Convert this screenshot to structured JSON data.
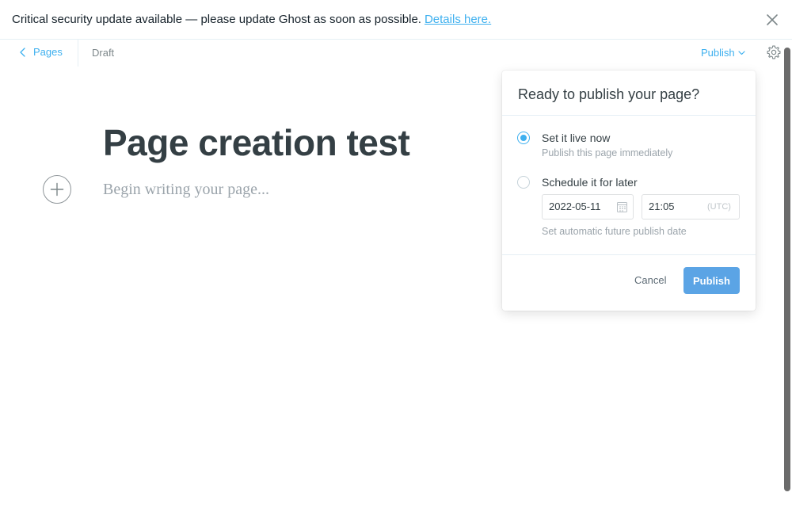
{
  "alert": {
    "message": "Critical security update available — please update Ghost as soon as possible.",
    "link_label": "Details here."
  },
  "header": {
    "back_label": "Pages",
    "status": "Draft",
    "publish_label": "Publish"
  },
  "editor": {
    "title": "Page creation test",
    "body_placeholder": "Begin writing your page..."
  },
  "publish_menu": {
    "title": "Ready to publish your page?",
    "options": [
      {
        "label": "Set it live now",
        "description": "Publish this page immediately",
        "selected": true
      },
      {
        "label": "Schedule it for later",
        "description": "Set automatic future publish date",
        "selected": false
      }
    ],
    "schedule": {
      "date": "2022-05-11",
      "time": "21:05",
      "timezone": "(UTC)"
    },
    "cancel_label": "Cancel",
    "publish_label": "Publish"
  },
  "colors": {
    "accent": "#3eb0ef",
    "publish_button": "#5ba4e5",
    "title_text": "#343f44",
    "muted_text": "#9ba4ab"
  }
}
